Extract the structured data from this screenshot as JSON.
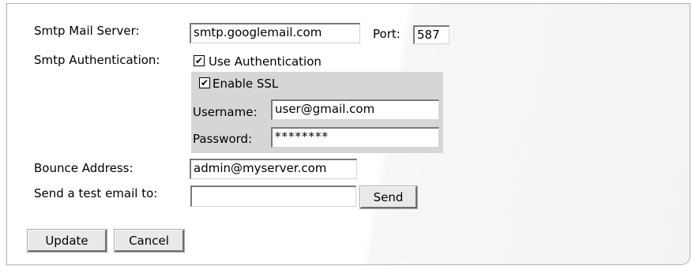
{
  "form": {
    "smtp_server_label": "Smtp Mail Server:",
    "smtp_server_value": "smtp.googlemail.com",
    "port_label": "Port:",
    "port_value": "587",
    "smtp_auth_label": "Smtp Authentication:",
    "use_auth_label": "Use Authentication",
    "use_auth_checked": true,
    "enable_ssl_label": "Enable SSL",
    "enable_ssl_checked": true,
    "username_label": "Username:",
    "username_value": "user@gmail.com",
    "password_label": "Password:",
    "password_value": "********",
    "bounce_label": "Bounce Address:",
    "bounce_value": "admin@myserver.com",
    "test_email_label": "Send a test email to:",
    "test_email_value": "",
    "send_button": "Send",
    "update_button": "Update",
    "cancel_button": "Cancel",
    "check_glyph": "✔"
  },
  "colors": {
    "auth_group_background": "#d6d6d6",
    "button_face": "#e9e9e9"
  }
}
